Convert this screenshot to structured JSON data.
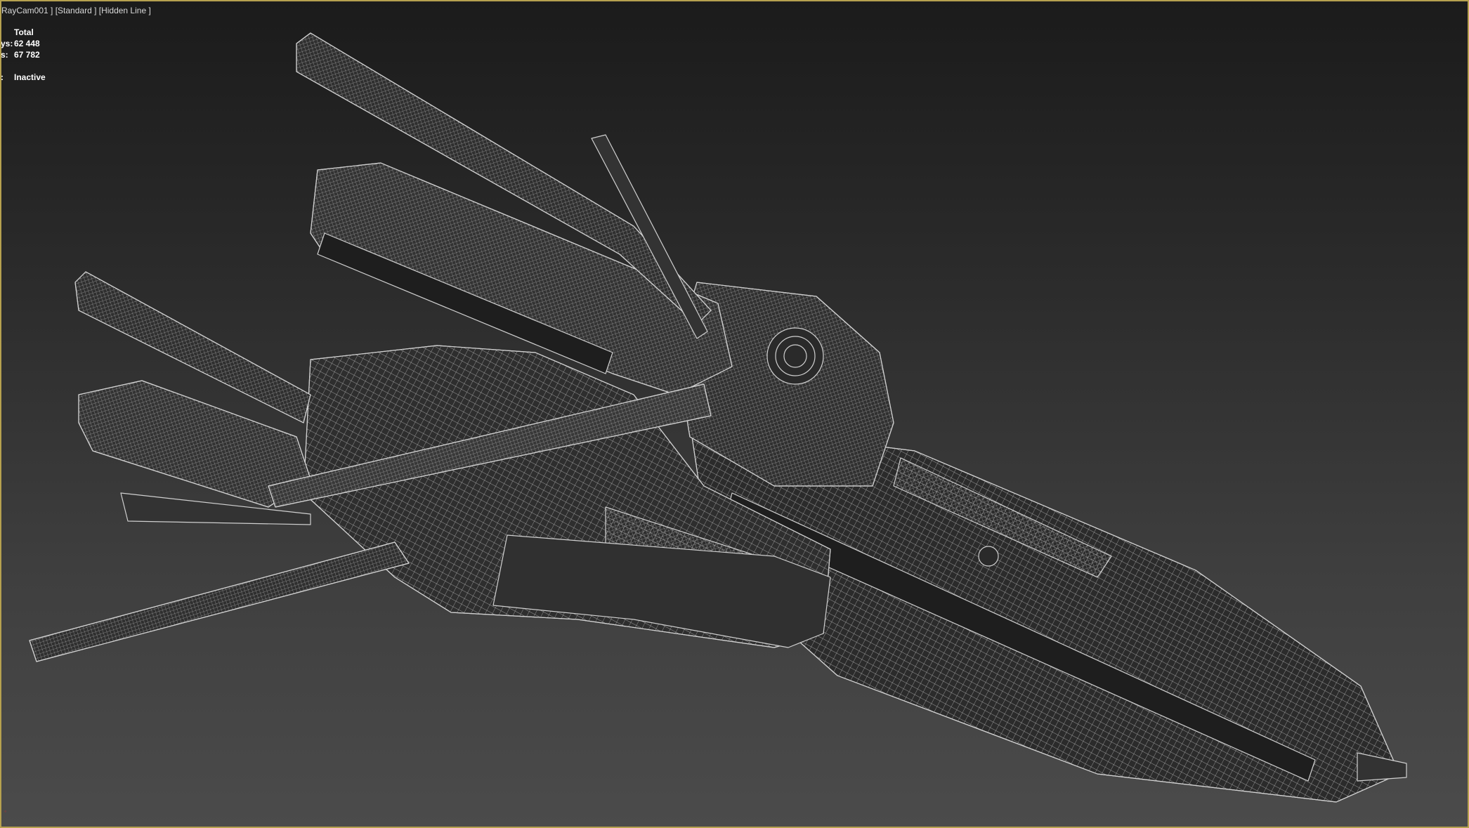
{
  "viewport": {
    "label": "RayCam001 ] [Standard ] [Hidden Line ]",
    "stats": {
      "header": "Total",
      "polys_key": "ys:",
      "polys_value": "62 448",
      "verts_key": "s:",
      "verts_value": "67 782",
      "fps_key": ":",
      "fps_value": "Inactive"
    },
    "border_color": "#b6a14f",
    "wire_color": "#d0d0d0"
  }
}
